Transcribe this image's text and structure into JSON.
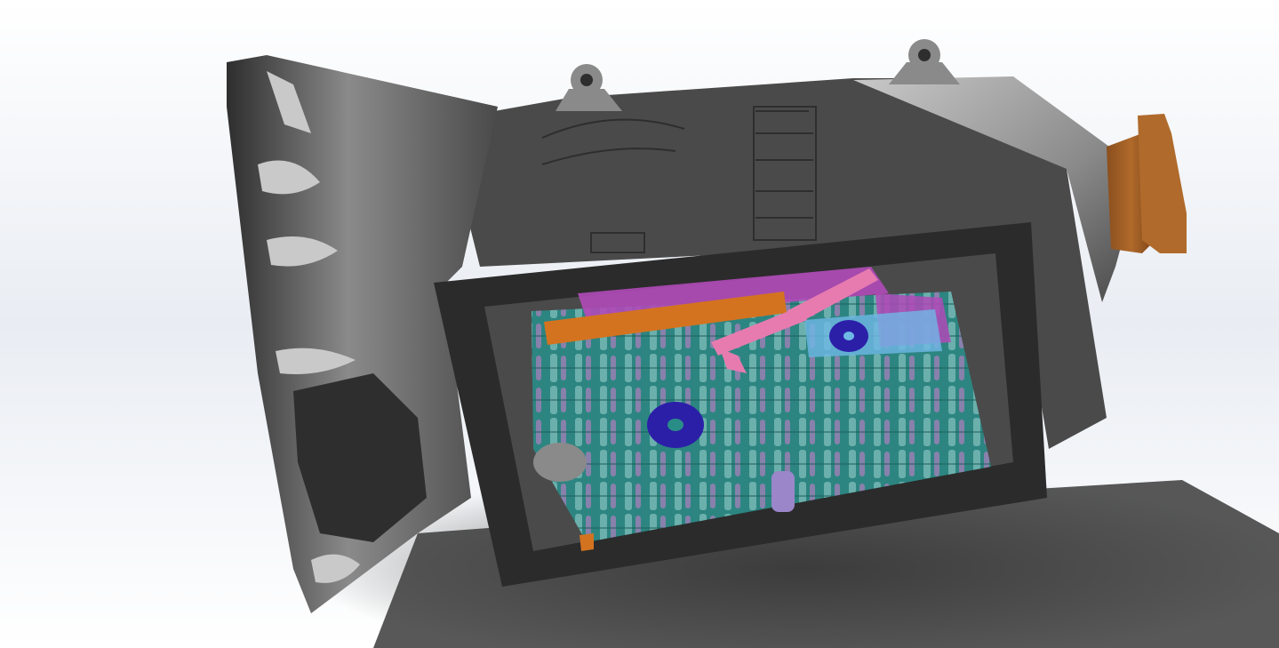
{
  "scene": {
    "subject": "transmission-assembly-3d-model",
    "colors": {
      "background_top": "#ffffff",
      "background_mid": "#e9edf3",
      "background_bottom": "#ffffff",
      "floor_shadow": "#3b3b3b",
      "housing_dark": "#2e2e2e",
      "housing_mid": "#4a4a4a",
      "housing_light": "#8a8a8a",
      "housing_highlight": "#c9c9c9",
      "pan_frame": "#2b2b2b",
      "valve_body_teal": "#2a8c87",
      "valve_body_magenta": "#b04ab8",
      "separator_orange": "#d4731f",
      "linkage_pink": "#e77bb0",
      "seal_blue": "#2b1fa8",
      "solenoid_lavender": "#9a86c9",
      "output_flange_bronze": "#b06a2b",
      "light_blue_part": "#6fb8e6"
    }
  }
}
